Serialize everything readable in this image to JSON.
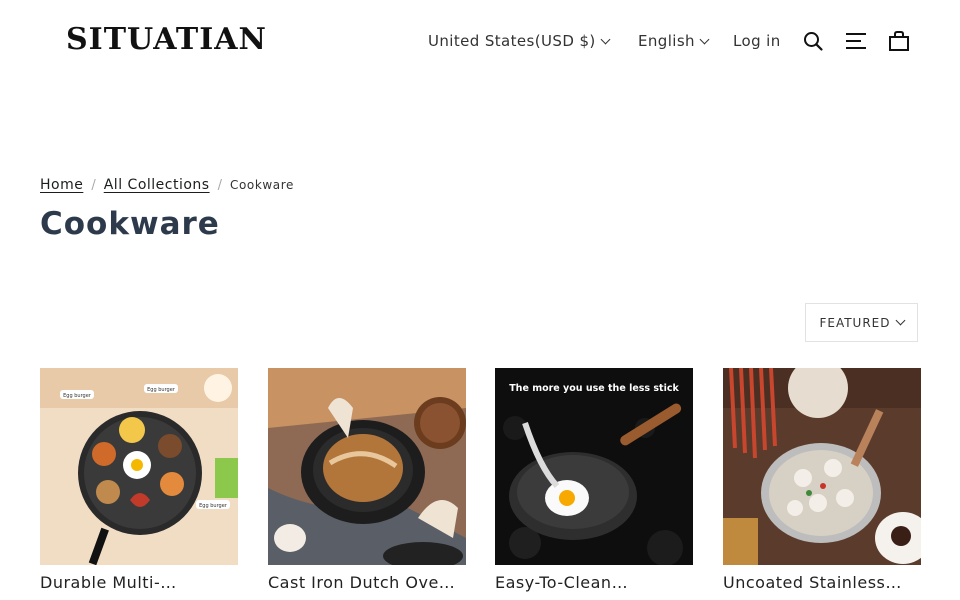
{
  "header": {
    "logo": "SITUATIAN",
    "currency": "United States(USD $)",
    "language": "English",
    "login": "Log in",
    "icons": [
      "search-icon",
      "menu-icon",
      "cart-icon"
    ]
  },
  "breadcrumb": {
    "home": "Home",
    "all_collections": "All Collections",
    "current": "Cookware",
    "separator": "/"
  },
  "page": {
    "title": "Cookware"
  },
  "sort": {
    "selected": "FEATURED"
  },
  "products": [
    {
      "name": "Durable Multi-…",
      "image_text": [
        "Egg burger",
        "Egg burger",
        "Egg burger"
      ]
    },
    {
      "name": "Cast Iron Dutch Ove…"
    },
    {
      "name": "Easy-To-Clean…",
      "image_text": [
        "The more you use the less stick"
      ]
    },
    {
      "name": "Uncoated Stainless…"
    }
  ],
  "colors": {
    "title": "#2d3a4b",
    "text": "#1c1d1d",
    "border": "#e2e2e2"
  }
}
